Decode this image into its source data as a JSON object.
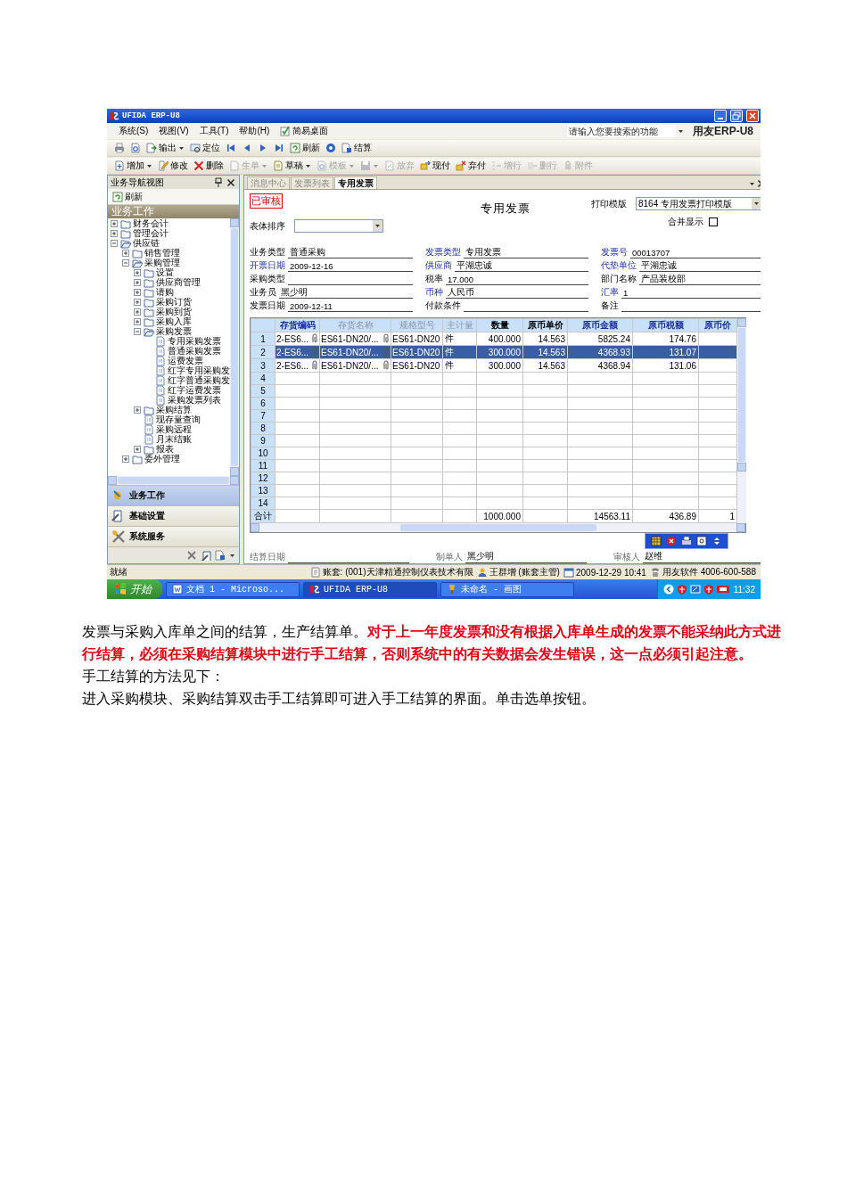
{
  "window": {
    "title": "UFIDA ERP-U8"
  },
  "menu": [
    "系统(S)",
    "视图(V)",
    "工具(T)",
    "帮助(H)",
    "简易桌面"
  ],
  "search": {
    "placeholder": "请输入您要搜索的功能"
  },
  "brand": "用友ERP-U8",
  "toolbar_1": [
    {
      "dropdown": false
    },
    {
      "dropdown": false
    },
    {
      "label": "输出",
      "dropdown": true
    },
    {
      "label": "定位",
      "dropdown": false
    },
    {
      "dropdown": false
    },
    {
      "dropdown": false
    },
    {
      "dropdown": false
    },
    {
      "dropdown": false
    },
    {
      "label": "刷新",
      "dropdown": false
    },
    {
      "dropdown": false
    },
    {
      "label": "结算",
      "dropdown": false
    }
  ],
  "toolbar_2": [
    {
      "label": "增加",
      "dropdown": true,
      "disabled": false
    },
    {
      "label": "修改",
      "dropdown": false,
      "disabled": false
    },
    {
      "label": "删除",
      "dropdown": false,
      "disabled": false
    },
    {
      "label": "生单",
      "dropdown": true,
      "disabled": true
    },
    {
      "label": "草稿",
      "dropdown": true,
      "disabled": false
    },
    {
      "label": "模板",
      "dropdown": true,
      "disabled": true
    },
    {
      "dropdown": true,
      "disabled": true
    },
    {
      "label": "放弃",
      "dropdown": false,
      "disabled": true
    },
    {
      "label": "现付",
      "dropdown": false,
      "disabled": false
    },
    {
      "label": "弃付",
      "dropdown": false,
      "disabled": false
    },
    {
      "label": "增行",
      "dropdown": false,
      "disabled": true
    },
    {
      "label": "删行",
      "dropdown": false,
      "disabled": true
    },
    {
      "label": "附件",
      "dropdown": false,
      "disabled": true
    }
  ],
  "nav_panel": {
    "title": "业务导航视图",
    "refresh": "刷新",
    "banner": "业务工作",
    "tree": [
      {
        "label": "财务会计",
        "kind": "folder",
        "expanded": false
      },
      {
        "label": "管理会计",
        "kind": "folder",
        "expanded": false
      },
      {
        "label": "供应链",
        "kind": "folder",
        "expanded": true,
        "children": [
          {
            "label": "销售管理",
            "kind": "folder",
            "expanded": false
          },
          {
            "label": "采购管理",
            "kind": "folder",
            "expanded": true,
            "children": [
              {
                "label": "设置",
                "kind": "folder",
                "expanded": false
              },
              {
                "label": "供应商管理",
                "kind": "folder",
                "expanded": false
              },
              {
                "label": "请购",
                "kind": "folder",
                "expanded": false
              },
              {
                "label": "采购订货",
                "kind": "folder",
                "expanded": false
              },
              {
                "label": "采购到货",
                "kind": "folder",
                "expanded": false
              },
              {
                "label": "采购入库",
                "kind": "folder",
                "expanded": false
              },
              {
                "label": "采购发票",
                "kind": "folder",
                "expanded": true,
                "children": [
                  {
                    "label": "专用采购发票",
                    "kind": "leaf"
                  },
                  {
                    "label": "普通采购发票",
                    "kind": "leaf"
                  },
                  {
                    "label": "运费发票",
                    "kind": "leaf"
                  },
                  {
                    "label": "红字专用采购发",
                    "kind": "leaf"
                  },
                  {
                    "label": "红字普通采购发",
                    "kind": "leaf"
                  },
                  {
                    "label": "红字运费发票",
                    "kind": "leaf"
                  },
                  {
                    "label": "采购发票列表",
                    "kind": "leaf"
                  }
                ]
              },
              {
                "label": "采购结算",
                "kind": "folder",
                "expanded": false
              },
              {
                "label": "现存量查询",
                "kind": "leaf"
              },
              {
                "label": "采购远程",
                "kind": "leaf"
              },
              {
                "label": "月末结账",
                "kind": "leaf"
              },
              {
                "label": "报表",
                "kind": "folder",
                "expanded": false
              }
            ]
          },
          {
            "label": "委外管理",
            "kind": "folder",
            "expanded": false
          }
        ]
      }
    ],
    "buttons": [
      {
        "label": "业务工作",
        "selected": true
      },
      {
        "label": "基础设置",
        "selected": false
      },
      {
        "label": "系统服务",
        "selected": false
      }
    ]
  },
  "tabs": [
    {
      "label": "消息中心",
      "selected": false
    },
    {
      "label": "发票列表",
      "selected": false
    },
    {
      "label": "专用发票",
      "selected": true
    }
  ],
  "invoice": {
    "stamp": "已审核",
    "title": "专用发票",
    "print_template": {
      "label": "打印模版",
      "value": "8164 专用发票打印模版"
    },
    "sort": {
      "label": "表体排序"
    },
    "merge": {
      "label": "合并显示",
      "checked": false
    },
    "fields": [
      {
        "label": "业务类型",
        "value": "普通采购",
        "required": false
      },
      {
        "label": "发票类型",
        "value": "专用发票",
        "required": true
      },
      {
        "label": "发票号",
        "value": "00013707",
        "required": true
      },
      {
        "label": "开票日期",
        "value": "2009-12-16",
        "required": true
      },
      {
        "label": "供应商",
        "value": "平湖忠诚",
        "required": true
      },
      {
        "label": "代垫单位",
        "value": "平湖忠诚",
        "required": true
      },
      {
        "label": "采购类型",
        "required": false
      },
      {
        "label": "税率",
        "value": "17.000",
        "required": false
      },
      {
        "label": "部门名称",
        "value": "产品装校部",
        "required": false
      },
      {
        "label": "业务员",
        "value": "黑少明",
        "required": false
      },
      {
        "label": "币种",
        "value": "人民币",
        "required": true
      },
      {
        "label": "汇率",
        "value": "1",
        "required": true
      },
      {
        "label": "发票日期",
        "value": "2009-12-11",
        "required": false
      },
      {
        "label": "付款条件",
        "required": false
      },
      {
        "label": "备注",
        "required": false
      }
    ],
    "grid": {
      "columns": [
        {
          "label": "存货编码",
          "kind": "required"
        },
        {
          "label": "存货名称",
          "kind": "readonly"
        },
        {
          "label": "规格型号",
          "kind": "readonly"
        },
        {
          "label": "主计量",
          "kind": "readonly"
        },
        {
          "label": "数量",
          "kind": "normal"
        },
        {
          "label": "原币单价",
          "kind": "normal"
        },
        {
          "label": "原币金额",
          "kind": "required"
        },
        {
          "label": "原币税额",
          "kind": "required"
        },
        {
          "label": "原币价",
          "kind": "required"
        }
      ],
      "rows": [
        {
          "number": "1",
          "selected": false,
          "cells": [
            "2-ES6...",
            "ES61-DN20/...",
            "ES61-DN20",
            "件",
            "400.000",
            "14.563",
            "5825.24",
            "174.76",
            null
          ]
        },
        {
          "number": "2",
          "selected": true,
          "cells": [
            "2-ES6...",
            "ES61-DN20/...",
            "ES61-DN20",
            "件",
            "300.000",
            "14.563",
            "4368.93",
            "131.07",
            null
          ]
        },
        {
          "number": "3",
          "selected": false,
          "cells": [
            "2-ES6...",
            "ES61-DN20/...",
            "ES61-DN20",
            "件",
            "300.000",
            "14.563",
            "4368.94",
            "131.06",
            null
          ]
        },
        {
          "number": "4",
          "selected": false
        },
        {
          "number": "5",
          "selected": false
        },
        {
          "number": "6",
          "selected": false
        },
        {
          "number": "7",
          "selected": false
        },
        {
          "number": "8",
          "selected": false
        },
        {
          "number": "9",
          "selected": false
        },
        {
          "number": "10",
          "selected": false
        },
        {
          "number": "11",
          "selected": false
        },
        {
          "number": "12",
          "selected": false
        },
        {
          "number": "13",
          "selected": false
        },
        {
          "number": "14",
          "selected": false
        }
      ],
      "total": {
        "label": "合计",
        "cells": [
          null,
          null,
          null,
          null,
          "1000.000",
          null,
          "14563.11",
          "436.89",
          "1"
        ]
      }
    },
    "footer_fields": [
      {
        "label": "结算日期"
      },
      {
        "label": "制单人",
        "value": "黑少明"
      },
      {
        "label": "审核人",
        "value": "赵维"
      }
    ]
  },
  "status_bar": {
    "text": "就绪",
    "items": [
      "账套: (001)天津精通控制仪表技术有限",
      "王群增 (账套主管)",
      "2009-12-29  10:41",
      "用友软件  4006-600-588"
    ]
  },
  "taskbar": {
    "start": "开始",
    "tasks": [
      {
        "label": "文档 1 - Microso...",
        "selected": false
      },
      {
        "label": "UFIDA ERP-U8",
        "selected": true
      },
      {
        "label": "未命名 - 画图",
        "selected": false
      }
    ],
    "clock": "11:32"
  },
  "document": {
    "paragraphs": [
      {
        "segments": [
          {
            "text": "发票与采购入库单之间的结算，生产结算单。",
            "emphasis": false
          },
          {
            "text": "对于上一年度发票和没有根据入库单生成的发票不能采纳此方式进行结算，必须在采购结算模块中进行手工结算，否则系统中的有关数据会发生错误，这一点必须引起注意。",
            "emphasis": true
          }
        ]
      },
      {
        "segments": [
          {
            "text": "手工结算的方法见下：",
            "emphasis": false
          }
        ]
      },
      {
        "segments": [
          {
            "text": "进入采购模块、采购结算双击手工结算即可进入手工结算的界面。单击选单按钮。",
            "emphasis": false
          }
        ]
      }
    ]
  }
}
